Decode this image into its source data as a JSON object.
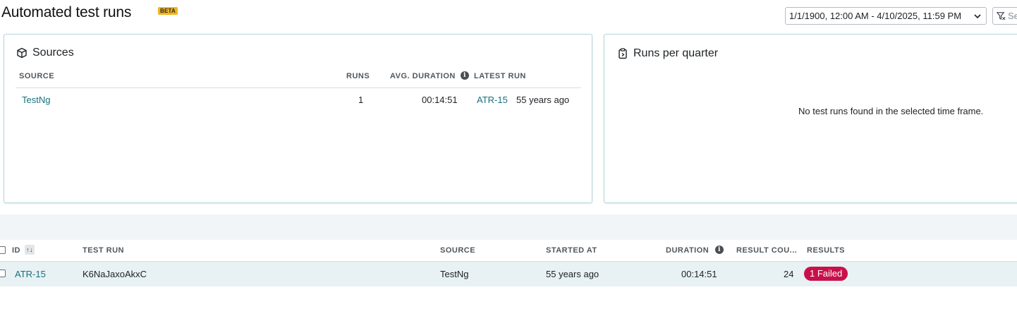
{
  "header": {
    "title": "Automated test runs",
    "beta": "BETA",
    "date_range": "1/1/1900, 12:00 AM - 4/10/2025, 11:59 PM",
    "filter_placeholder": "Se"
  },
  "sources_card": {
    "title": "Sources",
    "columns": {
      "source": "SOURCE",
      "runs": "RUNS",
      "avg_duration": "AVG. DURATION",
      "latest_run": "LATEST RUN"
    },
    "rows": [
      {
        "source": "TestNg",
        "runs": "1",
        "avg_duration": "00:14:51",
        "latest_run_id": "ATR-15",
        "latest_run_age": "55 years ago"
      }
    ]
  },
  "quarter_card": {
    "title": "Runs per quarter",
    "empty_message": "No test runs found in the selected time frame."
  },
  "runs_table": {
    "columns": {
      "id": "ID",
      "test_run": "TEST RUN",
      "source": "SOURCE",
      "started_at": "STARTED AT",
      "duration": "DURATION",
      "result_count": "RESULT COU...",
      "results": "RESULTS"
    },
    "rows": [
      {
        "id": "ATR-15",
        "test_run": "K6NaJaxoAkxC",
        "source": "TestNg",
        "started_at": "55 years ago",
        "duration": "00:14:51",
        "result_count": "24",
        "results": "1 Failed"
      }
    ]
  },
  "colors": {
    "link": "#17717d",
    "beta": "#f1b51c",
    "failed": "#c8104a",
    "row_highlight": "#e8f1f3"
  }
}
